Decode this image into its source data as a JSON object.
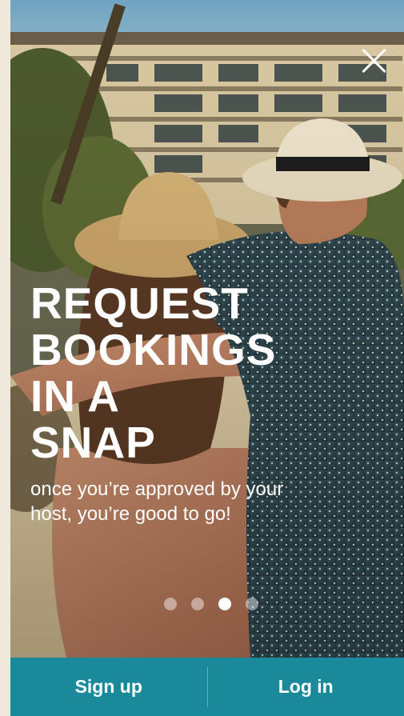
{
  "slide": {
    "headline": "REQUEST\nBOOKINGS\nIN A\nSNAP",
    "subtext": "once you’re approved by your host, you’re good to go!"
  },
  "pagination": {
    "total": 4,
    "active_index": 2
  },
  "footer": {
    "signup_label": "Sign up",
    "login_label": "Log in"
  },
  "colors": {
    "footer_bg": "#1a8a9b",
    "text": "#ffffff"
  },
  "icons": {
    "close": "close-icon"
  }
}
